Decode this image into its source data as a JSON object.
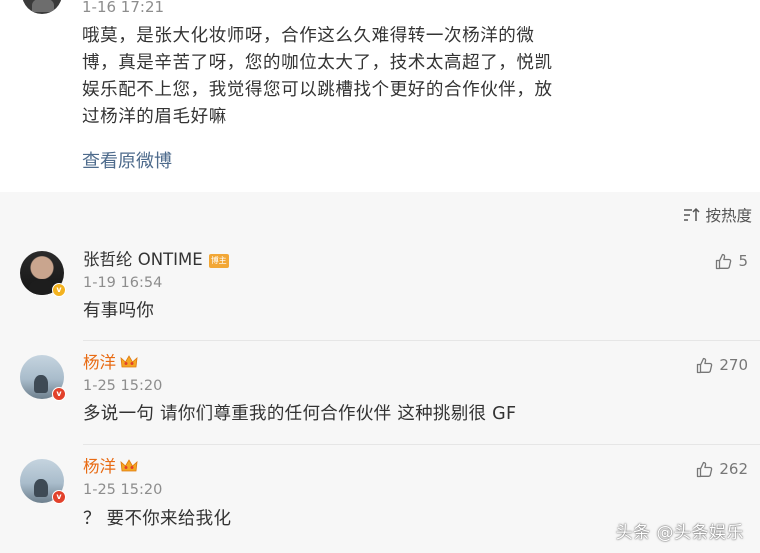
{
  "post": {
    "time": "1-16 17:21",
    "body": "哦莫，是张大化妆师呀，合作这么久难得转一次杨洋的微博，真是辛苦了呀，您的咖位太大了，技术太高超了，悦凯娱乐配不上您，我觉得您可以跳槽找个更好的合作伙伴，放过杨洋的眉毛好嘛",
    "view_original": "查看原微博"
  },
  "sort": {
    "label": "按热度",
    "icon": "sort-icon"
  },
  "comments": [
    {
      "name": "张哲纶 ONTIME",
      "tag": "博主",
      "time": "1-19 16:54",
      "text": "有事吗你",
      "likes": "5",
      "verified": "v"
    },
    {
      "name": "杨洋",
      "time": "1-25 15:20",
      "text": "多说一句 请你们尊重我的任何合作伙伴 这种挑剔很 GF",
      "likes": "270",
      "verified": "v"
    },
    {
      "name": "杨洋",
      "time": "1-25 15:20",
      "text": "？ 要不你来给我化",
      "likes": "262",
      "verified": "v"
    }
  ],
  "watermark": "头条 @头条娱乐",
  "colors": {
    "link": "#4e6b8c",
    "vip_name": "#e86b14",
    "comment_bg": "#f7f7f7"
  }
}
